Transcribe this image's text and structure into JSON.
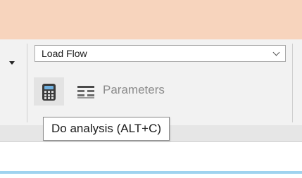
{
  "ribbon": {
    "analysis_selector": {
      "selected": "Load Flow"
    },
    "buttons": {
      "parameters_label": "Parameters"
    },
    "icons": {
      "calculate": "calculator-icon",
      "parameters": "parameters-list-icon",
      "combo_chevron": "chevron-down-icon",
      "left_caret": "caret-down-icon"
    }
  },
  "tooltip": {
    "text": "Do analysis (ALT+C)"
  },
  "colors": {
    "title_band": "#f7d4bd",
    "ribbon_background": "#f2f2f2",
    "accent_line": "#9fd3ef"
  }
}
